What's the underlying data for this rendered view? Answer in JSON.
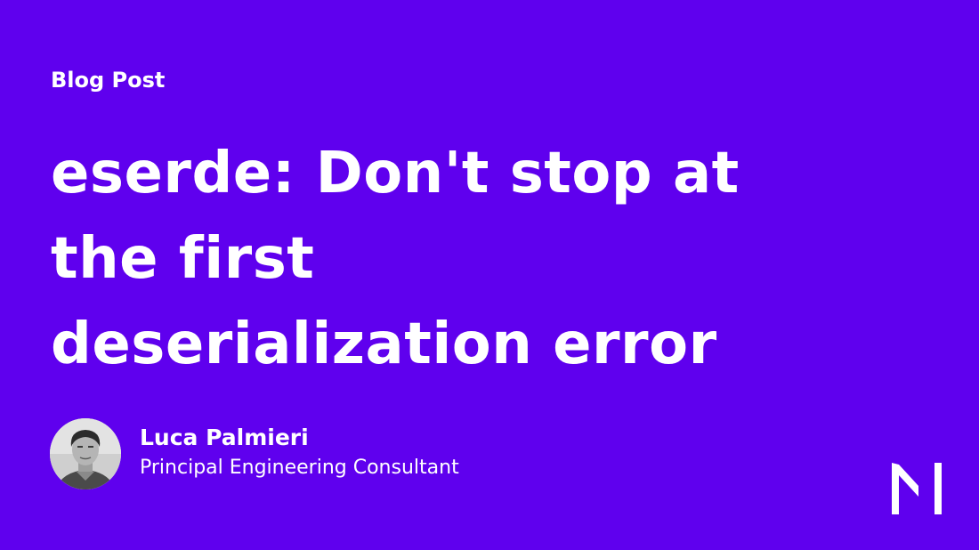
{
  "brand": {
    "background_color": "#5f00ee",
    "text_color": "#ffffff",
    "logo": "mainmatter-m-logo"
  },
  "post": {
    "label": "Blog Post",
    "title_lines": [
      "eserde: Don't stop at",
      "the first",
      "deserialization error"
    ]
  },
  "author": {
    "avatar": "author-photo",
    "name": "Luca Palmieri",
    "role": "Principal Engineering Consultant"
  }
}
